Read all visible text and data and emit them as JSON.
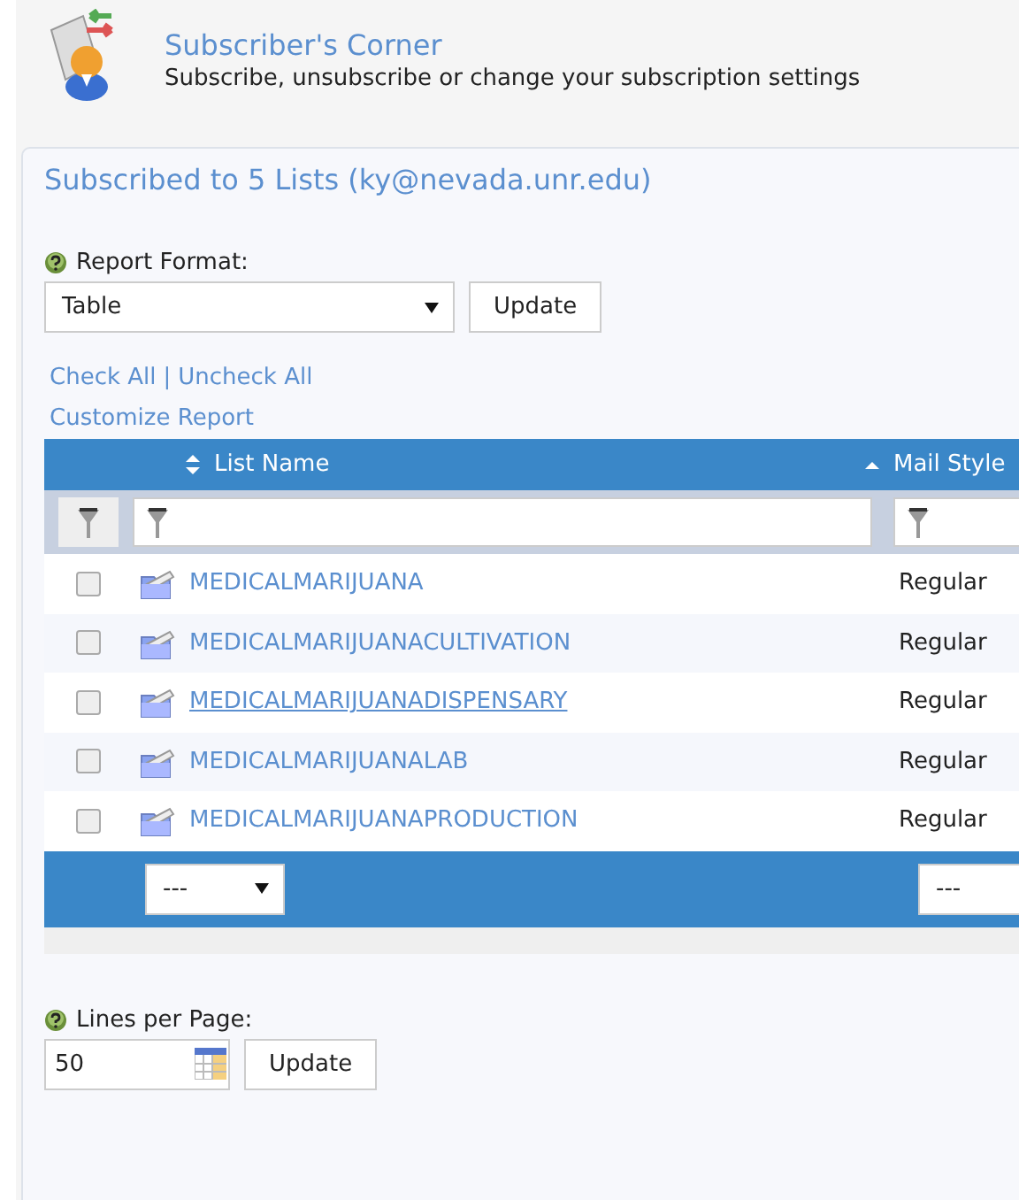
{
  "header": {
    "title": "Subscriber's Corner",
    "subtitle": "Subscribe, unsubscribe or change your subscription settings"
  },
  "panel": {
    "heading": "Subscribed to 5 Lists (ky@nevada.unr.edu)",
    "report_format": {
      "label": "Report Format:",
      "value": "Table",
      "button": "Update"
    },
    "links": {
      "check_all": "Check All",
      "separator": "|",
      "uncheck_all": "Uncheck All",
      "customize": "Customize Report"
    },
    "table": {
      "columns": [
        {
          "label": "List Name",
          "sorted": false
        },
        {
          "label": "Mail Style",
          "sorted": true
        }
      ],
      "rows": [
        {
          "name": "MEDICALMARIJUANA",
          "mail_style": "Regular",
          "checked": false,
          "hovered": false
        },
        {
          "name": "MEDICALMARIJUANACULTIVATION",
          "mail_style": "Regular",
          "checked": false,
          "hovered": false
        },
        {
          "name": "MEDICALMARIJUANADISPENSARY",
          "mail_style": "Regular",
          "checked": false,
          "hovered": true
        },
        {
          "name": "MEDICALMARIJUANALAB",
          "mail_style": "Regular",
          "checked": false,
          "hovered": false
        },
        {
          "name": "MEDICALMARIJUANAPRODUCTION",
          "mail_style": "Regular",
          "checked": false,
          "hovered": false
        }
      ],
      "footer_selects": [
        "---",
        "---"
      ]
    },
    "lines_per_page": {
      "label": "Lines per Page:",
      "value": "50",
      "button": "Update"
    }
  }
}
